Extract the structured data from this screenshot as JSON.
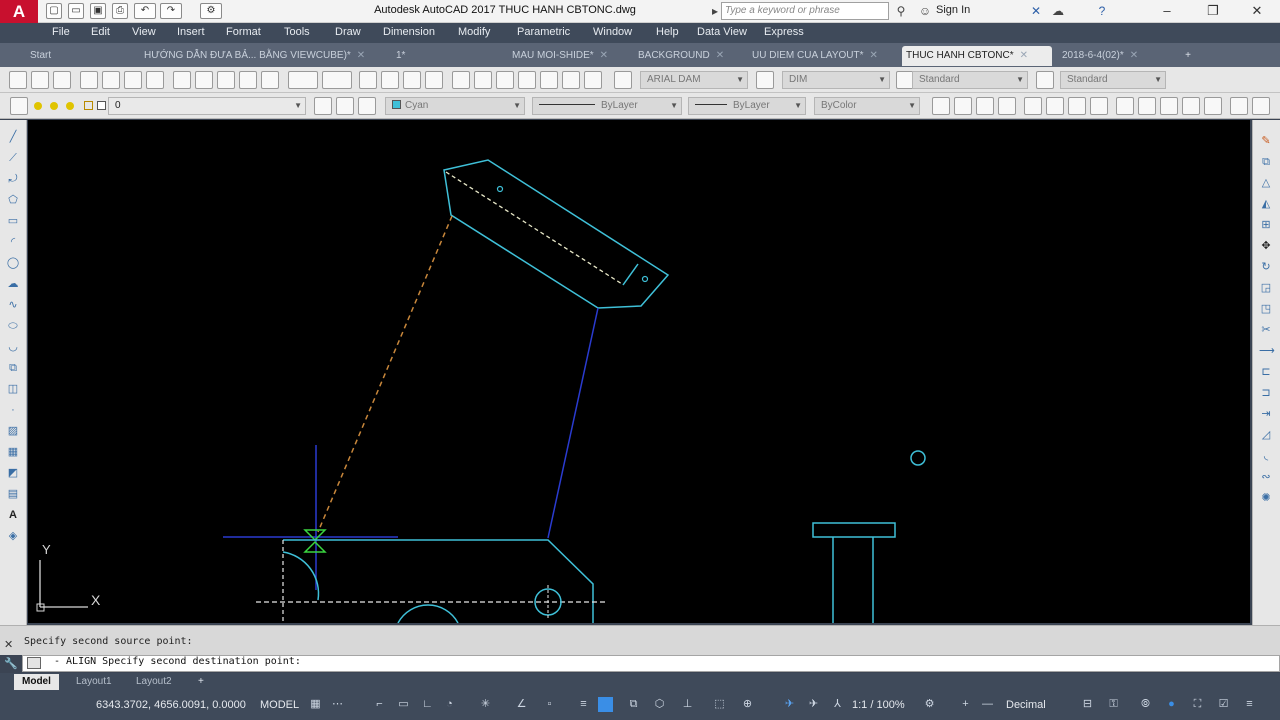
{
  "titlebar": {
    "logo": "A",
    "title": "Autodesk AutoCAD 2017   THUC HANH CBTONC.dwg",
    "search_placeholder": "Type a keyword or phrase",
    "signin": "Sign In"
  },
  "menu": [
    "File",
    "Edit",
    "View",
    "Insert",
    "Format",
    "Tools",
    "Draw",
    "Dimension",
    "Modify",
    "Parametric",
    "Window",
    "Help",
    "Data View",
    "Express"
  ],
  "file_tabs": [
    {
      "label": "Start",
      "active": false
    },
    {
      "label": "HƯỚNG DẪN ĐƯA BẢ... BẰNG VIEWCUBE)*",
      "active": false
    },
    {
      "label": "1*",
      "active": false
    },
    {
      "label": "MAU MOI-SHIDE*",
      "active": false
    },
    {
      "label": "BACKGROUND",
      "active": false
    },
    {
      "label": "UU DIEM CUA LAYOUT*",
      "active": false
    },
    {
      "label": "THUC HANH CBTONC*",
      "active": true
    },
    {
      "label": "2018-6-4(02)*",
      "active": false
    }
  ],
  "toolbar1": {
    "text_style": "ARIAL DAM",
    "dim_style": "DIM",
    "table_style": "Standard",
    "multileader_style": "Standard"
  },
  "toolbar2": {
    "layer": "0",
    "color": "Cyan",
    "linetype": "ByLayer",
    "lineweight": "ByLayer",
    "plotstyle": "ByColor"
  },
  "ucs": {
    "x_label": "X",
    "y_label": "Y"
  },
  "command": {
    "history_line": "Specify second source point:",
    "prompt": "- ALIGN Specify second destination point:"
  },
  "layout_tabs": [
    {
      "label": "Model",
      "active": true
    },
    {
      "label": "Layout1",
      "active": false
    },
    {
      "label": "Layout2",
      "active": false
    }
  ],
  "status": {
    "coords": "6343.3702, 4656.0091, 0.0000",
    "space": "MODEL",
    "scale": "1:1 / 100%",
    "units": "Decimal"
  },
  "colors": {
    "drawing_cyan": "#3fc0d8",
    "construction_dash": "#c8873b",
    "snap_green": "#3ad640",
    "tracking_blue": "#2a3bd0",
    "canvas_bg": "#000000"
  }
}
